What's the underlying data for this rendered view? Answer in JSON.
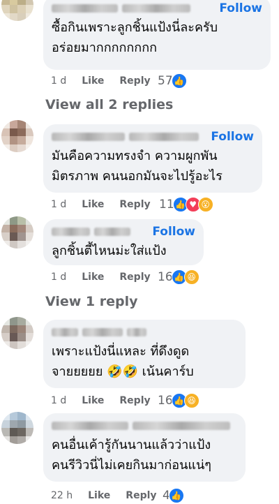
{
  "comments": [
    {
      "text": "ซื้อกินเพราะลูกชิ้นแป้งนี่ละครับ\nอร่อยมากกกกกกกก",
      "time": "1 d",
      "like": "Like",
      "reply": "Reply",
      "count": "57",
      "follow": "Follow",
      "reactions": [
        "like"
      ]
    },
    {
      "text": "มันคือความทรงจำ ความผูกพัน\nมิตรภาพ คนนอกมันจะไปรู้อะไร",
      "time": "1 d",
      "like": "Like",
      "reply": "Reply",
      "count": "11",
      "follow": "Follow",
      "reactions": [
        "like",
        "love",
        "wow"
      ]
    },
    {
      "text": "ลูกชิ้นตี้ไหนม่ะใส่แป้ง",
      "time": "1 d",
      "like": "Like",
      "reply": "Reply",
      "count": "16",
      "follow": "Follow",
      "reactions": [
        "like",
        "haha"
      ]
    },
    {
      "text": "เพราะแป้งนี่แหละ ที่ดึงดูด\nจายยยยย 🤣🤣 เน้นคาร์บ",
      "time": "1 d",
      "like": "Like",
      "reply": "Reply",
      "count": "16",
      "reactions": [
        "like",
        "haha"
      ]
    },
    {
      "text": "คนอื่นเค้ารู้กันนานแล้วว่าแป้ง\nคนรีวิวนี่ไม่เคยกินมาก่อนแน่ๆ",
      "time": "22 h",
      "like": "Like",
      "reply": "Reply",
      "count": "4",
      "reactions": [
        "like"
      ]
    }
  ],
  "view_replies": [
    "View all 2 replies",
    "View 1 reply"
  ],
  "icons": {
    "like": "thumbs-up-icon",
    "love": "heart-icon",
    "wow": "wow-face-icon",
    "haha": "laughing-face-icon"
  },
  "colors": {
    "accent": "#1b74e4",
    "bubble": "#f0f2f5",
    "muted": "#65676b"
  }
}
